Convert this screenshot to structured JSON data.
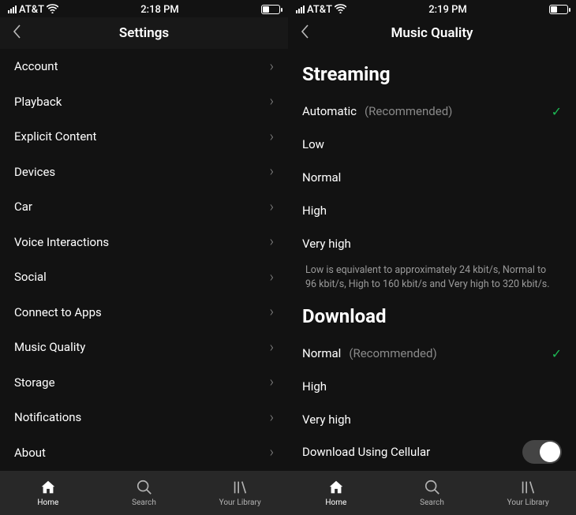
{
  "left": {
    "status": {
      "carrier": "AT&T",
      "time": "2:18 PM"
    },
    "title": "Settings",
    "items": [
      "Account",
      "Playback",
      "Explicit Content",
      "Devices",
      "Car",
      "Voice Interactions",
      "Social",
      "Connect to Apps",
      "Music Quality",
      "Storage",
      "Notifications",
      "About"
    ],
    "tabs": {
      "home": "Home",
      "search": "Search",
      "library": "Your Library"
    }
  },
  "right": {
    "status": {
      "carrier": "AT&T",
      "time": "2:19 PM"
    },
    "title": "Music Quality",
    "streaming": {
      "heading": "Streaming",
      "options": [
        {
          "label": "Automatic",
          "suffix": "(Recommended)",
          "checked": true
        },
        {
          "label": "Low"
        },
        {
          "label": "Normal"
        },
        {
          "label": "High"
        },
        {
          "label": "Very high"
        }
      ],
      "info": "Low is equivalent to approximately 24 kbit/s, Normal to 96 kbit/s, High to 160 kbit/s and Very high to 320 kbit/s."
    },
    "download": {
      "heading": "Download",
      "options": [
        {
          "label": "Normal",
          "suffix": "(Recommended)",
          "checked": true
        },
        {
          "label": "High"
        },
        {
          "label": "Very high"
        }
      ],
      "cellular": "Download Using Cellular"
    },
    "tabs": {
      "home": "Home",
      "search": "Search",
      "library": "Your Library"
    }
  }
}
